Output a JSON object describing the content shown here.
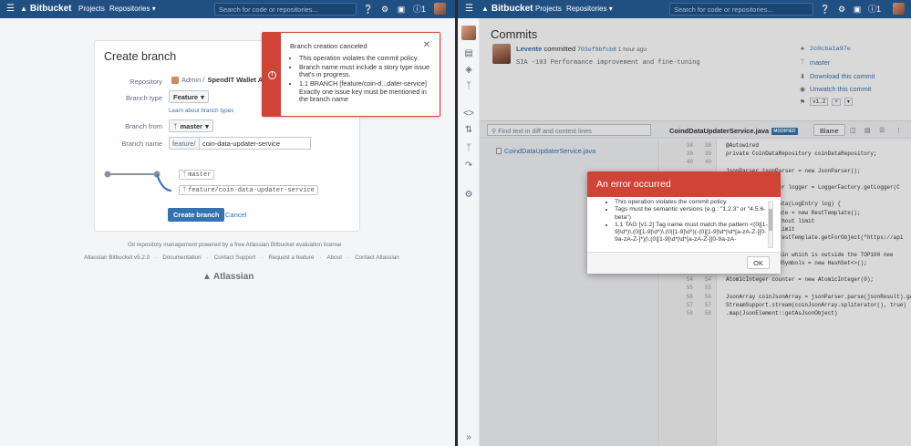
{
  "left": {
    "topbar": {
      "brand": "Bitbucket",
      "nav_projects": "Projects",
      "nav_repositories": "Repositories ▾",
      "search_placeholder": "Search for code or repositories...",
      "notif_count": "1"
    },
    "form": {
      "title": "Create branch",
      "repository_label": "Repository",
      "repository_value_prefix": "Admin / ",
      "repository_value_name": "SpendIT Wallet App",
      "branch_type_label": "Branch type",
      "branch_type_value": "Feature",
      "learn_link": "Learn about branch types",
      "branch_from_label": "Branch from",
      "branch_from_value": "master",
      "branch_name_label": "Branch name",
      "branch_name_prefix": "feature/",
      "branch_name_value": "coin-data-updater-service",
      "diagram_source": "master",
      "diagram_target": "feature/coin-data-updater-service",
      "create_button": "Create branch",
      "cancel_link": "Cancel"
    },
    "flag": {
      "title": "Branch creation canceled",
      "items": [
        "This operation violates the commit policy.",
        "Branch name must include a story type issue that's in progress.",
        "1.1 BRANCH [feature/coin-d...dater-service] Exactly one issue key must be mentioned in the branch name"
      ]
    },
    "footer": {
      "powered": "Git repository management powered by a free Atlassian Bitbucket evaluation license",
      "links": [
        "Atlassian Bitbucket v5.2.0",
        "·",
        "Documentation",
        "·",
        "Contact Support",
        "·",
        "Request a feature",
        "·",
        "About",
        "·",
        "Contact Atlassian"
      ],
      "logo": "Atlassian"
    }
  },
  "right": {
    "topbar": {
      "brand": "Bitbucket",
      "nav_projects": "Projects",
      "nav_repositories": "Repositories ▾",
      "search_placeholder": "Search for code or repositories...",
      "notif_count": "1"
    },
    "page_title": "Commits",
    "commit": {
      "author": "Levente",
      "verb": " committed ",
      "hash": "703ef9bfcb8",
      "time": " 1 hour ago",
      "message": "SIA -103 Performance improvement and fine-tuning"
    },
    "side_meta": {
      "hash": "2c0cba1a97e",
      "branch": "master",
      "download": "Download this commit",
      "unwatch": "Unwatch this commit",
      "tag": "v1.2"
    },
    "diff": {
      "filter_placeholder": "Find text in diff and context lines",
      "file_name": "CoindDataUpdaterService.java",
      "modified_badge": "MODIFIED",
      "blame_button": "Blame",
      "tree_file": "CoindDataUpdaterService.java"
    },
    "code_lines": [
      {
        "a": "38",
        "b": "38",
        "t": "@Autowired"
      },
      {
        "a": "39",
        "b": "39",
        "t": "private CoinDataRepository coinDataRepository;"
      },
      {
        "a": "40",
        "b": "40",
        "t": ""
      },
      {
        "a": "",
        "b": "",
        "t": "JsonParser jsonParser = new JsonParser();"
      },
      {
        "a": "",
        "b": "",
        "t": ""
      },
      {
        "a": "",
        "b": "",
        "t": "tatic final Logger logger = LoggerFactory.getLogger(C"
      },
      {
        "a": "",
        "b": "",
        "t": ""
      },
      {
        "a": "",
        "b": "",
        "t": "d updateAllCoinData(LogEntry log) {"
      },
      {
        "a": "",
        "b": "",
        "t": "mplate restTemplate = new RestTemplate();"
      },
      {
        "a": "",
        "b": "",
        "t": "ll coin data, without limit"
      },
      {
        "a": "",
        "b": "",
        "t": "coin data, with limit"
      },
      {
        "a": "",
        "b": "",
        "t": "ng jsonResult = restTemplate.getForObject(\"https://api"
      },
      {
        "a": "",
        "b": "",
        "t": ""
      },
      {
        "a": "",
        "b": "",
        "t": "emember if any coin which is outside the TOP100 nee"
      },
      {
        "a": "",
        "b": "",
        "t": "String> processedSymbols = new HashSet<>();"
      },
      {
        "a": "",
        "b": "",
        "t": ""
      },
      {
        "a": "54",
        "b": "54",
        "t": "AtomicInteger counter = new AtomicInteger(0);"
      },
      {
        "a": "55",
        "b": "55",
        "t": ""
      },
      {
        "a": "56",
        "b": "56",
        "t": "JsonArray coinJsonArray = jsonParser.parse(jsonResult).get"
      },
      {
        "a": "57",
        "b": "57",
        "t": "StreamSupport.stream(coinJsonArray.spliterator(), true)"
      },
      {
        "a": "58",
        "b": "58",
        "t": "    .map(JsonElement::getAsJsonObject)"
      }
    ],
    "modal": {
      "title": "An error occurred",
      "items": [
        "This operation violates the commit policy.",
        "Tags must be semantic versions (e.g.: \"1.2.3\" or \"4.5.6-beta\")",
        "1.1 TAG [v1.2] Tag name must match the pattern <(0|[1-9]\\d*)\\.(0|[1-9]\\d*)\\.(0|[1-9]\\d*)(-(0|[1-9]\\d*|\\d*[a-zA-Z-][0-9a-zA-Z-]*)(\\.(0|[1-9]\\d*|\\d*[a-zA-Z-][0-9a-zA-"
      ],
      "ok_button": "OK"
    }
  }
}
